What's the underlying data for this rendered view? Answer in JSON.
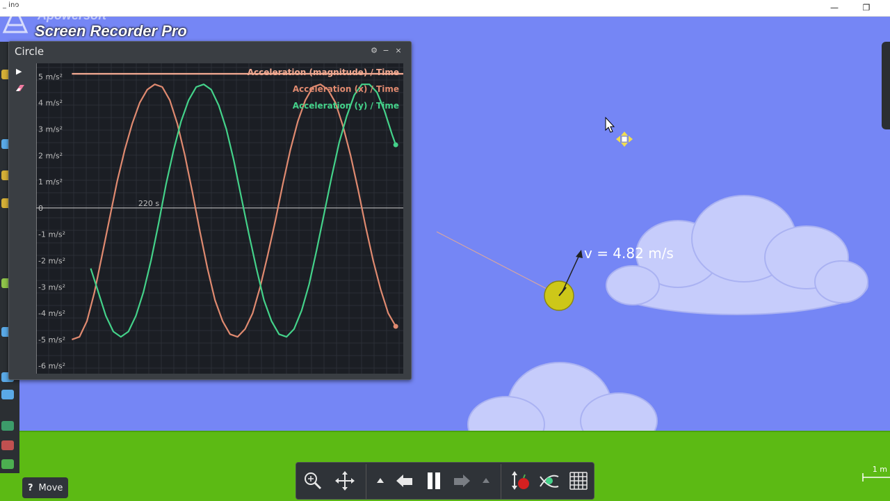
{
  "window": {
    "title_fragment": "_ ino",
    "minimize_glyph": "—",
    "restore_glyph": "❐"
  },
  "watermark": {
    "brand": "Apowersoft",
    "product": "Screen Recorder Pro"
  },
  "graph_panel": {
    "title": "Circle",
    "buttons": [
      "settings",
      "minimize",
      "close"
    ],
    "settings_glyph": "⚙",
    "minimize_glyph": "−",
    "close_glyph": "×",
    "play_glyph": "▶"
  },
  "chart_data": {
    "type": "line",
    "legend_placement": "top-right",
    "grid": true,
    "xlabel": "",
    "ylabel": "",
    "x_tick_labels": [
      "220 s"
    ],
    "y_tick_labels": [
      "5 m/s²",
      "4 m/s²",
      "3 m/s²",
      "2 m/s²",
      "1 m/s²",
      "0",
      "-1 m/s²",
      "-2 m/s²",
      "-3 m/s²",
      "-4 m/s²",
      "-5 m/s²",
      "-6 m/s²"
    ],
    "ylim": [
      -6.3,
      5.5
    ],
    "y_ticks": [
      5,
      4,
      3,
      2,
      1,
      0,
      -1,
      -2,
      -3,
      -4,
      -5,
      -6
    ],
    "series": [
      {
        "name": "Acceleration (magnitude) / Time",
        "color": "#f0a890",
        "values": [
          [
            202,
            5.1
          ],
          [
            219,
            5.1
          ],
          [
            232,
            5.1
          ],
          [
            247,
            5.1
          ],
          [
            263,
            5.1
          ],
          [
            278,
            5.1
          ],
          [
            292,
            5.1
          ],
          [
            304,
            5.1
          ],
          [
            318,
            5.1
          ],
          [
            323,
            5.1
          ]
        ]
      },
      {
        "name": "Acceleration (x) / Time",
        "color": "#e08a70",
        "values": [
          [
            202,
            -5.0
          ],
          [
            204,
            -4.9
          ],
          [
            206,
            -4.3
          ],
          [
            208,
            -3.2
          ],
          [
            210,
            -1.8
          ],
          [
            212,
            -0.4
          ],
          [
            214,
            1.0
          ],
          [
            216,
            2.2
          ],
          [
            218,
            3.2
          ],
          [
            220,
            4.0
          ],
          [
            222,
            4.5
          ],
          [
            224,
            4.7
          ],
          [
            226,
            4.6
          ],
          [
            228,
            4.1
          ],
          [
            230,
            3.2
          ],
          [
            232,
            2.0
          ],
          [
            234,
            0.6
          ],
          [
            236,
            -0.9
          ],
          [
            238,
            -2.3
          ],
          [
            240,
            -3.5
          ],
          [
            242,
            -4.3
          ],
          [
            244,
            -4.8
          ],
          [
            246,
            -4.9
          ],
          [
            248,
            -4.6
          ],
          [
            250,
            -4.0
          ],
          [
            252,
            -3.0
          ],
          [
            254,
            -1.8
          ],
          [
            256,
            -0.5
          ],
          [
            258,
            0.9
          ],
          [
            260,
            2.2
          ],
          [
            262,
            3.3
          ],
          [
            264,
            4.1
          ],
          [
            266,
            4.6
          ],
          [
            268,
            4.7
          ],
          [
            270,
            4.5
          ],
          [
            272,
            4.0
          ],
          [
            274,
            3.1
          ],
          [
            276,
            2.0
          ],
          [
            278,
            0.7
          ],
          [
            280,
            -0.7
          ],
          [
            282,
            -2.0
          ],
          [
            284,
            -3.1
          ],
          [
            286,
            -4.0
          ],
          [
            288,
            -4.5
          ]
        ]
      },
      {
        "name": "Acceleration (y) / Time",
        "color": "#44d28a",
        "values": [
          [
            207,
            -2.3
          ],
          [
            209,
            -3.2
          ],
          [
            211,
            -4.1
          ],
          [
            213,
            -4.7
          ],
          [
            215,
            -4.9
          ],
          [
            217,
            -4.7
          ],
          [
            219,
            -4.1
          ],
          [
            221,
            -3.2
          ],
          [
            223,
            -2.0
          ],
          [
            225,
            -0.6
          ],
          [
            227,
            0.9
          ],
          [
            229,
            2.2
          ],
          [
            231,
            3.3
          ],
          [
            233,
            4.1
          ],
          [
            235,
            4.6
          ],
          [
            237,
            4.7
          ],
          [
            239,
            4.5
          ],
          [
            241,
            3.9
          ],
          [
            243,
            3.0
          ],
          [
            245,
            1.8
          ],
          [
            247,
            0.4
          ],
          [
            249,
            -1.0
          ],
          [
            251,
            -2.3
          ],
          [
            253,
            -3.5
          ],
          [
            255,
            -4.3
          ],
          [
            257,
            -4.8
          ],
          [
            259,
            -4.9
          ],
          [
            261,
            -4.6
          ],
          [
            263,
            -3.9
          ],
          [
            265,
            -2.9
          ],
          [
            267,
            -1.6
          ],
          [
            269,
            -0.2
          ],
          [
            271,
            1.2
          ],
          [
            273,
            2.5
          ],
          [
            275,
            3.5
          ],
          [
            277,
            4.3
          ],
          [
            279,
            4.7
          ],
          [
            281,
            4.7
          ],
          [
            283,
            4.4
          ],
          [
            285,
            3.7
          ],
          [
            287,
            2.8
          ],
          [
            288,
            2.4
          ]
        ]
      }
    ]
  },
  "scene": {
    "velocity_label": "v = 4.82 m/s",
    "scale_label": "1 m"
  },
  "toolbar": {
    "buttons": [
      "zoom",
      "move",
      "step-up",
      "undo",
      "pause",
      "redo",
      "step-down",
      "gravity",
      "show-motion",
      "grid"
    ]
  },
  "status": {
    "help_glyph": "?",
    "mode_label": "Move"
  }
}
